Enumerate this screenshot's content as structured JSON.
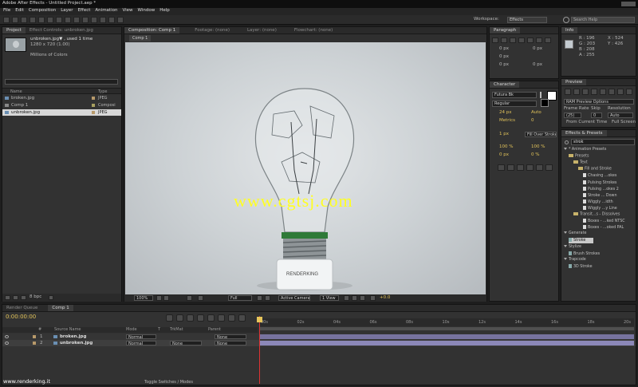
{
  "window": {
    "title": "Adobe After Effects - Untitled Project.aep *"
  },
  "menu": [
    "File",
    "Edit",
    "Composition",
    "Layer",
    "Effect",
    "Animation",
    "View",
    "Window",
    "Help"
  ],
  "workspace": {
    "label": "Workspace:",
    "value": "Effects",
    "search_placeholder": "Search Help"
  },
  "project": {
    "tabs": [
      "Project",
      "Effect Controls: unbroken.jpg"
    ],
    "selected_name": "unbroken.jpg▼ , used 1 time",
    "selected_size": "1280 x 720 (1.00)",
    "selected_colors": "Millions of Colors",
    "col_name": "Name",
    "col_type": "Type",
    "items": [
      {
        "name": "broken.jpg",
        "type": "JPEG"
      },
      {
        "name": "Comp 1",
        "type": "Composi"
      },
      {
        "name": "unbroken.jpg",
        "type": "JPEG"
      }
    ],
    "bpc": "8 bpc"
  },
  "comp": {
    "tabs": [
      "Composition: Comp 1",
      "Footage: (none)",
      "Layer: (none)",
      "Flowchart: (none)"
    ],
    "sub_tab": "Comp 1",
    "watermark": "www.cgtsj.com",
    "base_text": "RENDERKING",
    "zoom": "100%",
    "resolution": "Full",
    "camera": "Active Camera",
    "views": "1 View",
    "exposure": "+0.0"
  },
  "info": {
    "tab": "Info",
    "r": "R : 196",
    "g": "G : 203",
    "b": "B : 208",
    "a": "A : 255",
    "x": "X : 524",
    "y": "Y : 426"
  },
  "paragraph": {
    "tab": "Paragraph",
    "px": [
      "0 px",
      "0 px",
      "0 px",
      "0 px",
      "0 px"
    ]
  },
  "character": {
    "tab": "Character",
    "font": "Futura Bk",
    "style": "Regular",
    "size": "24 px",
    "leading": "Auto",
    "tracking": "0",
    "kerning": "Metrics",
    "stroke": "1 px",
    "stroke_type": "Fill Over Stroke",
    "vscale": "100 %",
    "hscale": "100 %",
    "baseline": "0 px",
    "tsume": "0 %"
  },
  "preview": {
    "tab": "Preview",
    "ram": "RAM Preview Options",
    "fr_label": "Frame Rate",
    "skip_label": "Skip",
    "res_label": "Resolution",
    "fr": "(25)",
    "skip": "0",
    "res": "Auto",
    "from_current": "From Current Time",
    "full_screen": "Full Screen"
  },
  "effects": {
    "tab": "Effects & Presets",
    "search": "strok",
    "tree": [
      {
        "label": "* Animation Presets",
        "depth": 0,
        "kind": "open"
      },
      {
        "label": "Presets",
        "depth": 1,
        "kind": "folder"
      },
      {
        "label": "Text",
        "depth": 2,
        "kind": "folder"
      },
      {
        "label": "Fill and Stroke",
        "depth": 3,
        "kind": "folder"
      },
      {
        "label": "Chasing ...okes",
        "depth": 4,
        "kind": "doc"
      },
      {
        "label": "Pulsing Strokes",
        "depth": 4,
        "kind": "doc"
      },
      {
        "label": "Pulsing ...okes 2",
        "depth": 4,
        "kind": "doc"
      },
      {
        "label": "Stroke ... Down",
        "depth": 4,
        "kind": "doc"
      },
      {
        "label": "Wiggly ...idth",
        "depth": 4,
        "kind": "doc"
      },
      {
        "label": "Wiggly ...y Line",
        "depth": 4,
        "kind": "doc"
      },
      {
        "label": "Transit...s - Dissolves",
        "depth": 2,
        "kind": "folder"
      },
      {
        "label": "Boxes - ...ked NTSC",
        "depth": 4,
        "kind": "doc"
      },
      {
        "label": "Boxes - ...oked PAL",
        "depth": 4,
        "kind": "doc"
      },
      {
        "label": "Generate",
        "depth": 0,
        "kind": "open"
      },
      {
        "label": "Stroke",
        "depth": 1,
        "kind": "fx",
        "selected": true
      },
      {
        "label": "Stylize",
        "depth": 0,
        "kind": "open"
      },
      {
        "label": "Brush Strokes",
        "depth": 1,
        "kind": "fx"
      },
      {
        "label": "Trapcode",
        "depth": 0,
        "kind": "open"
      },
      {
        "label": "3D Stroke",
        "depth": 1,
        "kind": "fx"
      }
    ]
  },
  "timeline": {
    "tabs": [
      "Render Queue",
      "Comp 1"
    ],
    "timecode": "0:00:00:00",
    "cols": {
      "num": "#",
      "source": "Source Name",
      "mode": "Mode",
      "t": "T",
      "trkmat": "TrkMat",
      "parent": "Parent"
    },
    "layers": [
      {
        "num": "1",
        "name": "broken.jpg",
        "mode": "Normal",
        "trkmat": "",
        "parent": "None"
      },
      {
        "num": "2",
        "name": "unbroken.jpg",
        "mode": "Normal",
        "trkmat": "None",
        "parent": "None"
      }
    ],
    "ruler": [
      "00s",
      "02s",
      "04s",
      "06s",
      "08s",
      "10s",
      "12s",
      "14s",
      "16s",
      "18s",
      "20s",
      "22s"
    ],
    "toggle": "Toggle Switches / Modes"
  },
  "footer_watermark": "www.renderking.it"
}
